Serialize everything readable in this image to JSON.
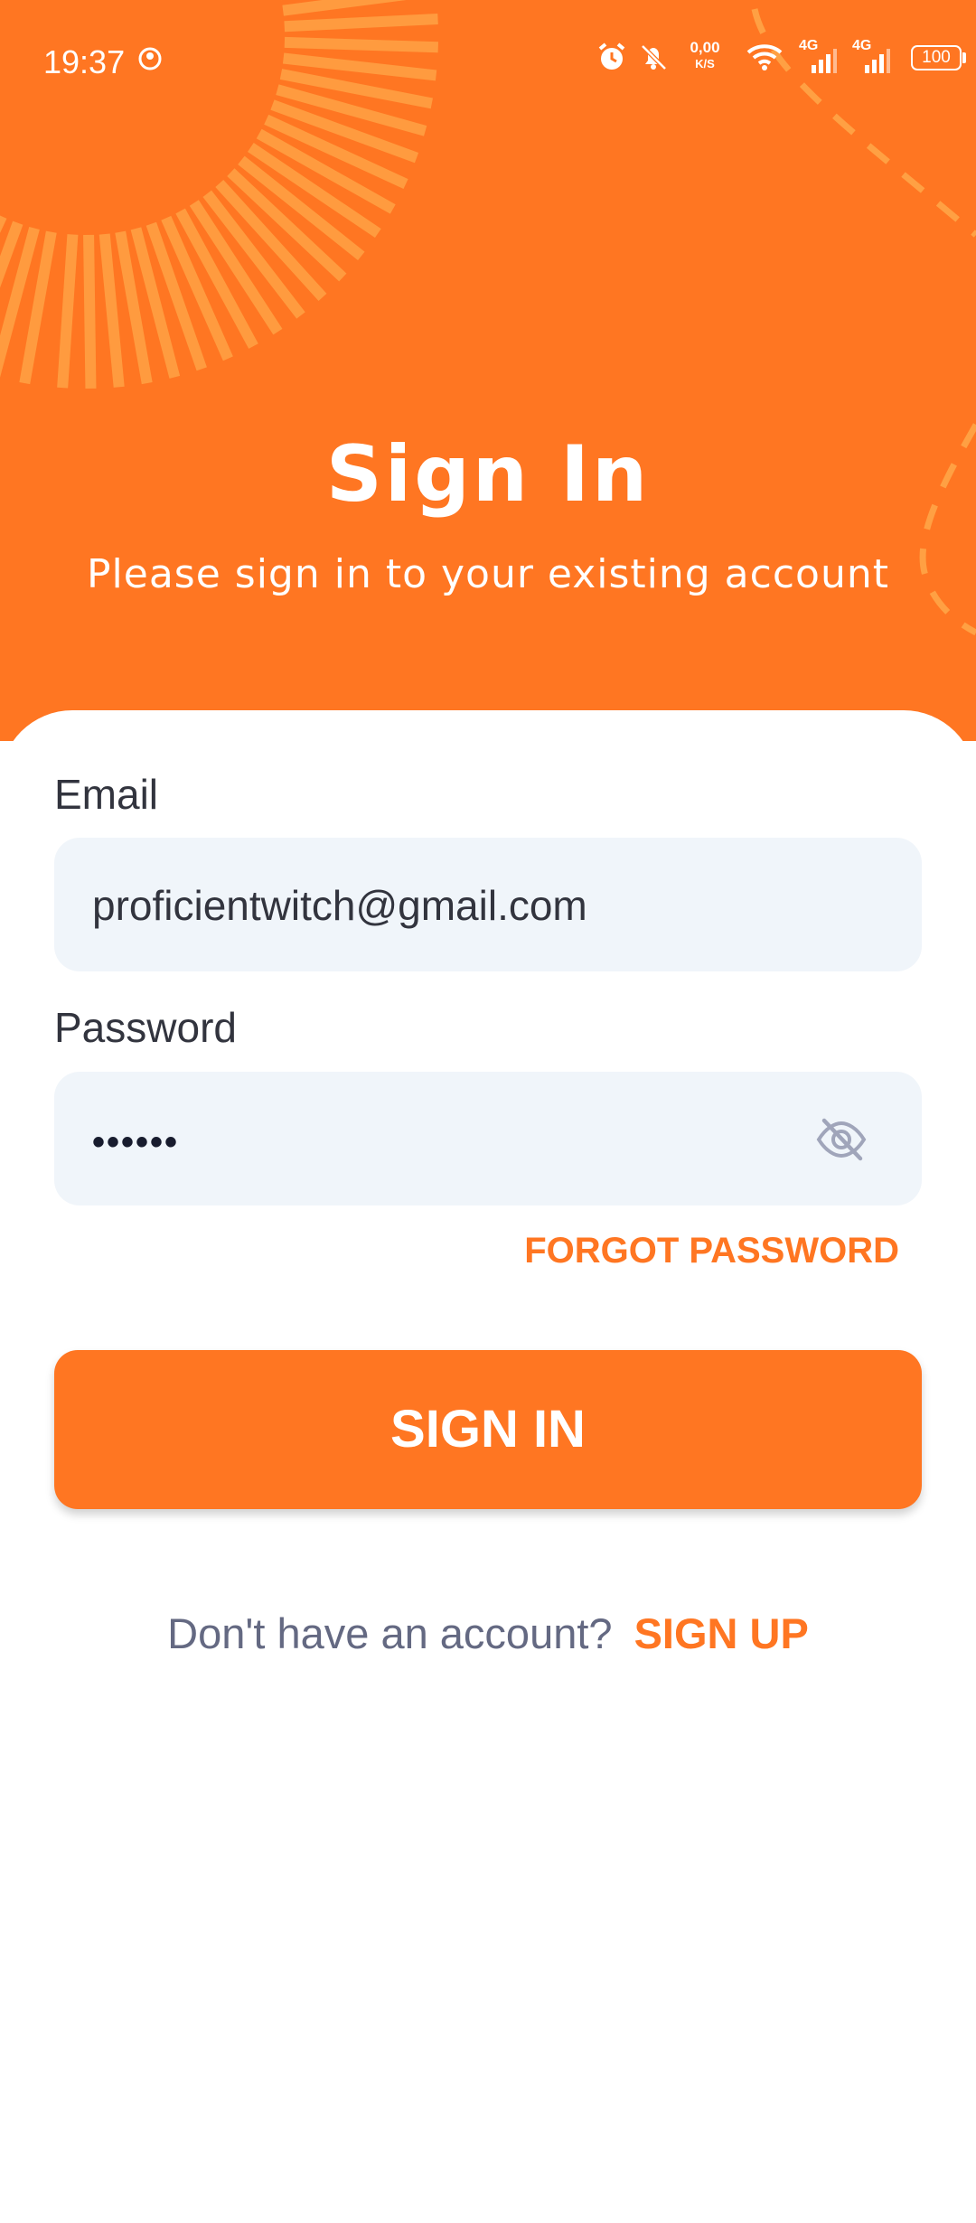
{
  "status_bar": {
    "time": "19:37",
    "net_speed_value": "0,00",
    "net_speed_unit": "K/S",
    "net1": "4G",
    "net2": "4G",
    "battery": "100",
    "icons": [
      "camera-status-icon",
      "alarm-icon",
      "bell-off-icon",
      "wifi-icon",
      "signal-icon",
      "signal-icon"
    ]
  },
  "header": {
    "title": "Sign In",
    "subtitle": "Please sign in to your existing account"
  },
  "form": {
    "email_label": "Email",
    "email_value": "proficientwitch@gmail.com",
    "password_label": "Password",
    "password_value": "••••••",
    "password_toggle_icon": "eye-off-icon",
    "forgot_password": "FORGOT PASSWORD",
    "submit": "SIGN IN"
  },
  "footer": {
    "question": "Don't have an account?",
    "signup": "SIGN UP"
  },
  "colors": {
    "accent": "#FF7622",
    "field_bg": "#F0F5FA",
    "text": "#32343E",
    "muted": "#646982"
  }
}
